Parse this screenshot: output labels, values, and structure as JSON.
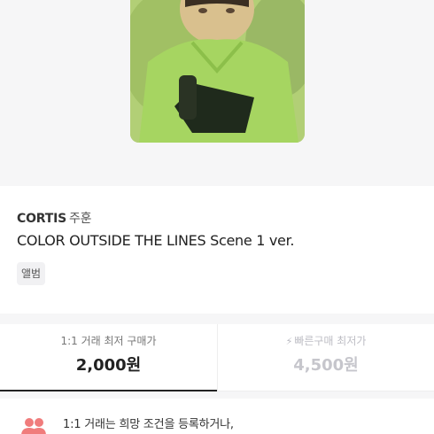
{
  "product": {
    "artist": "CORTIS",
    "member": "주훈",
    "title": "COLOR OUTSIDE THE LINES Scene 1 ver.",
    "tag": "앨범"
  },
  "price_tabs": [
    {
      "label": "1:1 거래 최저 구매가",
      "value": "2,000원",
      "selected": true
    },
    {
      "label": "빠른구매 최저가",
      "value": "4,500원",
      "icon": "lightning-icon",
      "selected": false
    }
  ],
  "notice": {
    "text": "1:1 거래는 희망 조건을 등록하거나,",
    "icon": "users-icon",
    "icon_color": "#f07c7c"
  }
}
